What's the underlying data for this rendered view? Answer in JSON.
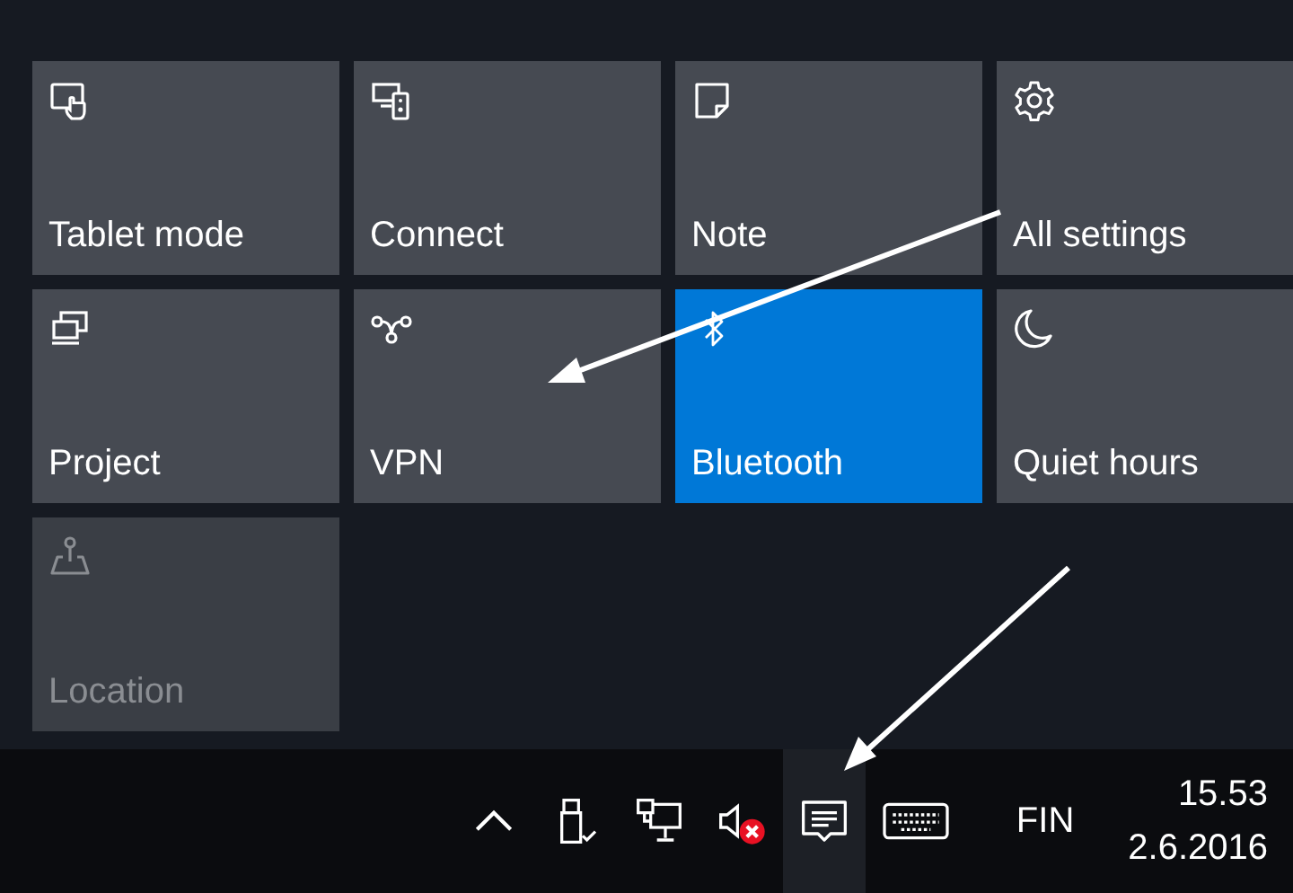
{
  "tiles": [
    {
      "label": "Tablet mode",
      "on": false,
      "disabled": false
    },
    {
      "label": "Connect",
      "on": false,
      "disabled": false
    },
    {
      "label": "Note",
      "on": false,
      "disabled": false
    },
    {
      "label": "All settings",
      "on": false,
      "disabled": false
    },
    {
      "label": "Project",
      "on": false,
      "disabled": false
    },
    {
      "label": "VPN",
      "on": false,
      "disabled": false
    },
    {
      "label": "Bluetooth",
      "on": true,
      "disabled": false
    },
    {
      "label": "Quiet hours",
      "on": false,
      "disabled": false
    },
    {
      "label": "Location",
      "on": false,
      "disabled": true
    }
  ],
  "taskbar": {
    "volume_muted": true,
    "action_center_selected": true,
    "language": "FIN",
    "time": "15.53",
    "date": "2.6.2016"
  }
}
